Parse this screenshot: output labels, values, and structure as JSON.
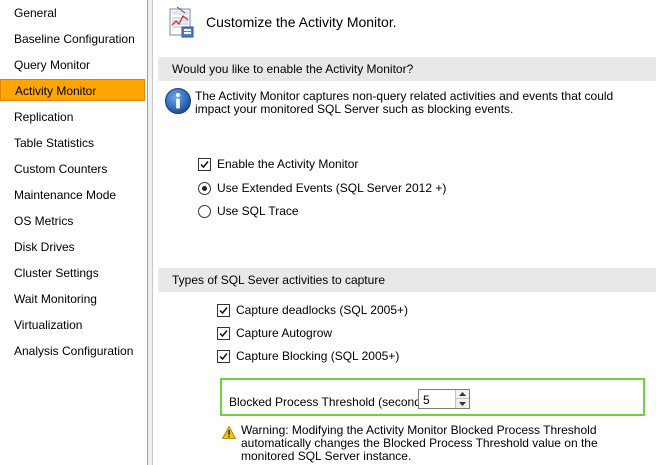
{
  "sidebar": {
    "items": [
      {
        "label": "General"
      },
      {
        "label": "Baseline Configuration"
      },
      {
        "label": "Query Monitor"
      },
      {
        "label": "Activity Monitor",
        "selected": true
      },
      {
        "label": "Replication"
      },
      {
        "label": "Table Statistics"
      },
      {
        "label": "Custom Counters"
      },
      {
        "label": "Maintenance Mode"
      },
      {
        "label": "OS Metrics"
      },
      {
        "label": "Disk Drives"
      },
      {
        "label": "Cluster Settings"
      },
      {
        "label": "Wait Monitoring"
      },
      {
        "label": "Virtualization"
      },
      {
        "label": "Analysis Configuration"
      }
    ],
    "selected_color": "#ffa500"
  },
  "header": {
    "title": "Customize the Activity Monitor.",
    "icon": "activity-monitor-icon"
  },
  "enable_section": {
    "title": "Would you like to enable the Activity Monitor?",
    "info_icon": "info-icon",
    "info_text": "The Activity Monitor captures non-query related activities and events that could impact your monitored SQL Server such as blocking events.",
    "enable_checkbox": {
      "label": "Enable the Activity Monitor",
      "checked": true
    },
    "radio_extended_events": {
      "label": "Use Extended Events (SQL Server 2012 +)",
      "checked": true
    },
    "radio_sql_trace": {
      "label": "Use SQL Trace",
      "checked": false
    }
  },
  "capture_section": {
    "title": "Types of SQL Sever activities to capture",
    "options": [
      {
        "label": "Capture deadlocks (SQL 2005+)",
        "checked": true
      },
      {
        "label": "Capture Autogrow",
        "checked": true
      },
      {
        "label": "Capture Blocking (SQL 2005+)",
        "checked": true
      }
    ],
    "threshold": {
      "label": "Blocked Process Threshold (seconds):",
      "value": "5",
      "highlight_color": "#6bd43c"
    },
    "warning_icon": "warning-icon",
    "warning_text": "Warning: Modifying the Activity Monitor Blocked Process Threshold automatically changes the Blocked Process Threshold value on the monitored SQL Server instance."
  }
}
